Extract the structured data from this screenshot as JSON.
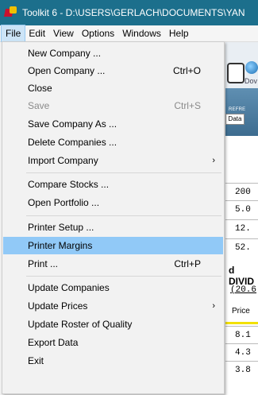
{
  "window": {
    "title": "Toolkit 6 - D:\\USERS\\GERLACH\\DOCUMENTS\\YAN"
  },
  "menubar": {
    "items": [
      "File",
      "Edit",
      "View",
      "Options",
      "Windows",
      "Help"
    ],
    "active": "File"
  },
  "file_menu": {
    "new_company": "New Company ...",
    "open_company": "Open Company ...",
    "open_company_shortcut": "Ctrl+O",
    "close": "Close",
    "save": "Save",
    "save_shortcut": "Ctrl+S",
    "save_company_as": "Save Company As ...",
    "delete_companies": "Delete Companies ...",
    "import_company": "Import Company",
    "compare_stocks": "Compare Stocks ...",
    "open_portfolio": "Open Portfolio ...",
    "printer_setup": "Printer Setup ...",
    "printer_margins": "Printer Margins",
    "print": "Print ...",
    "print_shortcut": "Ctrl+P",
    "update_companies": "Update Companies",
    "update_prices": "Update Prices",
    "update_roster": "Update Roster of Quality",
    "export_data": "Export Data",
    "exit": "Exit"
  },
  "background": {
    "toolbar_label": "Dov",
    "refresh_label": "REFRE",
    "tab_label": "Data",
    "values": [
      "200",
      "5.0",
      "12.",
      "52."
    ],
    "section_label": "d DIVID",
    "sub_value": "(20.6",
    "price_label": "Price",
    "prices": [
      "8.1",
      "4.3",
      "3.8"
    ]
  },
  "colors": {
    "titlebar": "#1c6f8c",
    "highlight": "#91c9f7",
    "menu_active": "#cce4f7"
  }
}
